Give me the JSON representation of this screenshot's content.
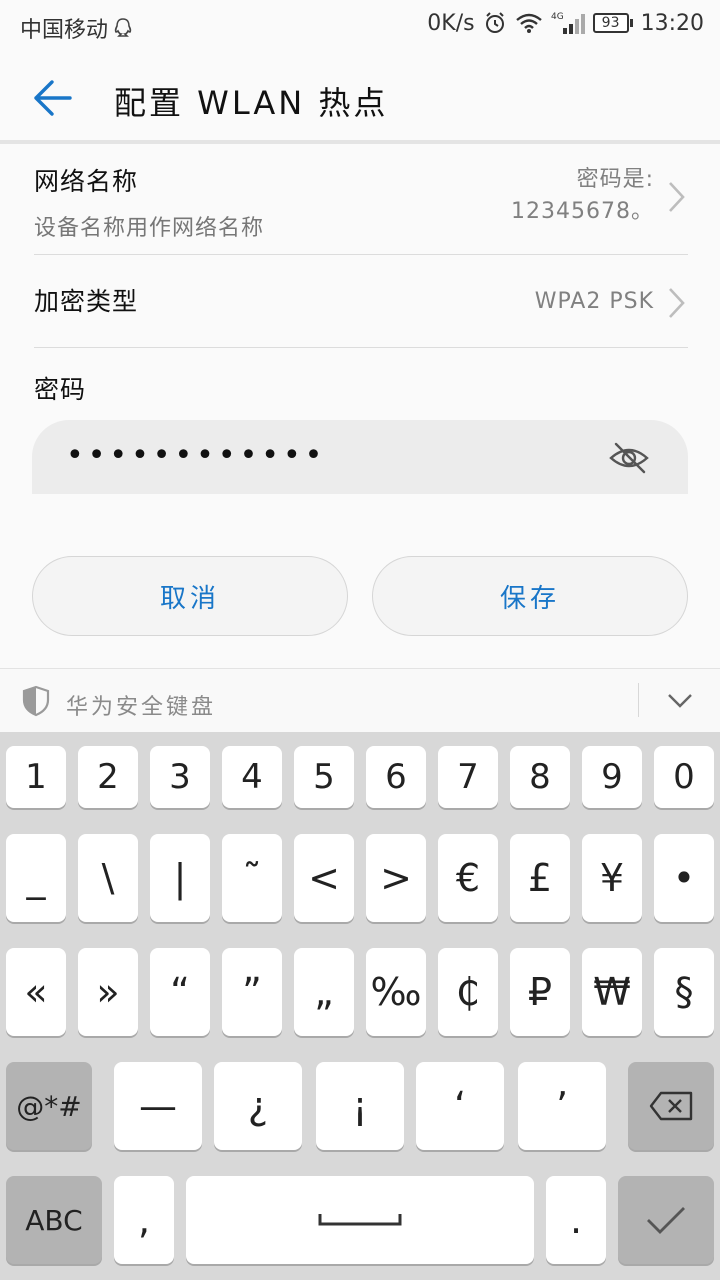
{
  "status_bar": {
    "carrier": "中国移动",
    "speed": "0K/s",
    "network": "4G",
    "battery": "93",
    "time": "13:20"
  },
  "header": {
    "title": "配置 WLAN 热点"
  },
  "network_name": {
    "title": "网络名称",
    "subtitle": "设备名称用作网络名称",
    "value_line1": "密码是:",
    "value_line2": "12345678。"
  },
  "encryption": {
    "title": "加密类型",
    "value": "WPA2 PSK"
  },
  "password": {
    "title": "密码",
    "value": "••••••••••••"
  },
  "buttons": {
    "cancel": "取消",
    "save": "保存"
  },
  "keyboard": {
    "title": "华为安全键盘",
    "row1": [
      "1",
      "2",
      "3",
      "4",
      "5",
      "6",
      "7",
      "8",
      "9",
      "0"
    ],
    "row2": [
      "_",
      "\\",
      "|",
      "˜",
      "<",
      ">",
      "€",
      "£",
      "¥",
      "•"
    ],
    "row3": [
      "«",
      "»",
      "“",
      "”",
      "„",
      "‰",
      "₵",
      "₽",
      "₩",
      "§"
    ],
    "row4": [
      "@*#",
      "—",
      "¿",
      "¡",
      "‘",
      "’"
    ],
    "row5": [
      "ABC",
      ",",
      ".",
      ""
    ]
  }
}
